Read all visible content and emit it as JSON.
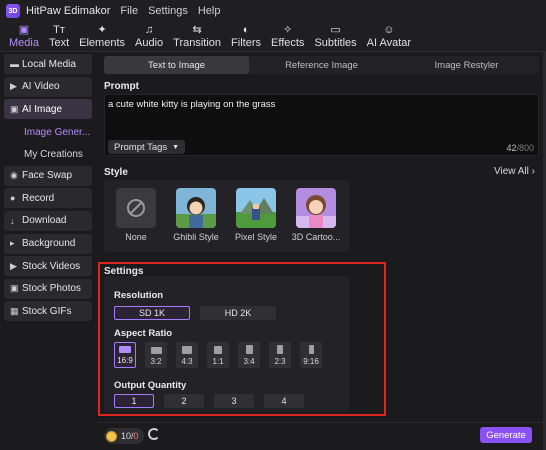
{
  "app": {
    "title": "HitPaw Edimakor",
    "logo_text": "3D",
    "menu": [
      "File",
      "Settings",
      "Help"
    ]
  },
  "toolbar": [
    {
      "label": "Media",
      "icon": "media-icon",
      "glyph": "▣",
      "active": true
    },
    {
      "label": "Text",
      "icon": "text-icon",
      "glyph": "Tт",
      "active": false
    },
    {
      "label": "Elements",
      "icon": "elements-icon",
      "glyph": "✦",
      "active": false
    },
    {
      "label": "Audio",
      "icon": "audio-icon",
      "glyph": "♫",
      "active": false
    },
    {
      "label": "Transition",
      "icon": "transition-icon",
      "glyph": "⇆",
      "active": false
    },
    {
      "label": "Filters",
      "icon": "filters-icon",
      "glyph": "◐",
      "active": false
    },
    {
      "label": "Effects",
      "icon": "effects-icon",
      "glyph": "✧",
      "active": false
    },
    {
      "label": "Subtitles",
      "icon": "subtitles-icon",
      "glyph": "▭",
      "active": false
    },
    {
      "label": "AI Avatar",
      "icon": "ai-avatar-icon",
      "glyph": "☺",
      "active": false
    }
  ],
  "sidebar": {
    "items": [
      {
        "label": "Local Media",
        "icon": "folder-icon",
        "glyph": "▬"
      },
      {
        "label": "AI Video",
        "icon": "ai-video-icon",
        "glyph": "▶"
      },
      {
        "label": "AI Image",
        "icon": "ai-image-icon",
        "glyph": "▣",
        "active": true
      },
      {
        "label": "Image Gener...",
        "sub": true,
        "active": true
      },
      {
        "label": "My Creations",
        "sub": true
      },
      {
        "label": "Face Swap",
        "icon": "face-swap-icon",
        "glyph": "◉"
      },
      {
        "label": "Record",
        "icon": "record-icon",
        "glyph": "●"
      },
      {
        "label": "Download",
        "icon": "download-icon",
        "glyph": "↓"
      },
      {
        "label": "Background",
        "icon": "background-icon",
        "glyph": "▸"
      },
      {
        "label": "Stock Videos",
        "icon": "stock-videos-icon",
        "glyph": "▶"
      },
      {
        "label": "Stock Photos",
        "icon": "stock-photos-icon",
        "glyph": "▣"
      },
      {
        "label": "Stock GIFs",
        "icon": "stock-gifs-icon",
        "glyph": "▦"
      }
    ]
  },
  "tabs": [
    {
      "label": "Text to Image",
      "active": true
    },
    {
      "label": "Reference Image",
      "active": false
    },
    {
      "label": "Image Restyler",
      "active": false
    }
  ],
  "prompt": {
    "heading": "Prompt",
    "text": "a cute white kitty is playing on the grass",
    "tags_label": "Prompt Tags",
    "count": "42",
    "max": "/800"
  },
  "style": {
    "heading": "Style",
    "view_all": "View All",
    "view_all_arrow": "›",
    "options": [
      "None",
      "Ghibli Style",
      "Pixel Style",
      "3D Cartoo..."
    ]
  },
  "settings": {
    "heading": "Settings",
    "resolution_label": "Resolution",
    "resolutions": [
      "SD 1K",
      "HD 2K"
    ],
    "selected_resolution": "SD 1K",
    "aspect_label": "Aspect Ratio",
    "aspects": [
      "16:9",
      "3:2",
      "4:3",
      "1:1",
      "3:4",
      "2:3",
      "9:16"
    ],
    "selected_aspect": "16:9",
    "quantity_label": "Output Quantity",
    "quantities": [
      "1",
      "2",
      "3",
      "4"
    ],
    "selected_quantity": "1"
  },
  "footer": {
    "credits_used": "10",
    "credits_sep": "/",
    "credits_left": "0",
    "generate_label": "Generate"
  },
  "colors": {
    "accent": "#8a52f5",
    "highlight_box": "#e0241f",
    "coin": "#f3c44b"
  }
}
